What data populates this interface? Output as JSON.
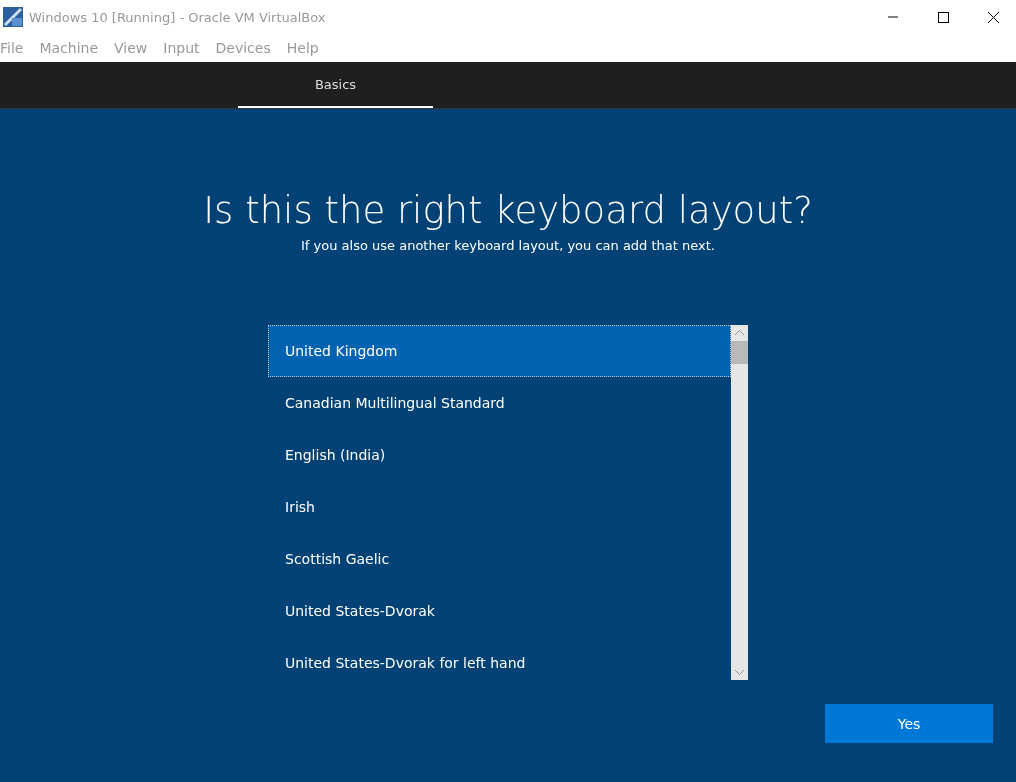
{
  "window": {
    "title": "Windows 10 [Running] - Oracle VM VirtualBox"
  },
  "menu": [
    "File",
    "Machine",
    "View",
    "Input",
    "Devices",
    "Help"
  ],
  "tabs": [
    {
      "label": "Basics",
      "selected": true
    }
  ],
  "heading": "Is this the right keyboard layout?",
  "subheading": "If you also use another keyboard layout, you can add that next.",
  "layouts": [
    {
      "label": "United Kingdom",
      "selected": true
    },
    {
      "label": "Canadian Multilingual Standard",
      "selected": false
    },
    {
      "label": "English (India)",
      "selected": false
    },
    {
      "label": "Irish",
      "selected": false
    },
    {
      "label": "Scottish Gaelic",
      "selected": false
    },
    {
      "label": "United States-Dvorak",
      "selected": false
    },
    {
      "label": "United States-Dvorak for left hand",
      "selected": false
    }
  ],
  "button": "Yes"
}
